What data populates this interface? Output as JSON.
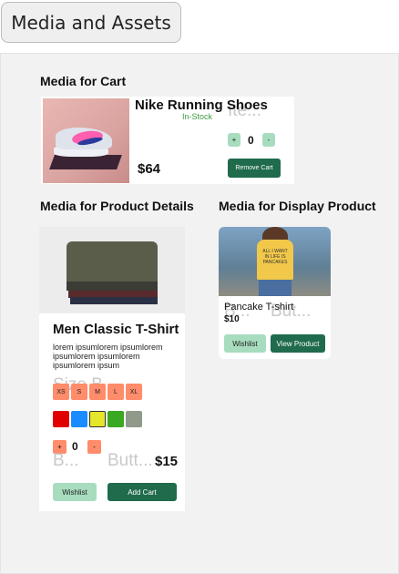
{
  "header": {
    "title": "Media and Assets"
  },
  "sections": {
    "cart": "Media for Cart",
    "details": "Media for Product Details",
    "display": "Media for Display Product"
  },
  "cart": {
    "product_name": "Nike Running Shoes",
    "stock_status": "In-Stock",
    "ghost_text": "Ite...",
    "quantity": "0",
    "increment_label": "+",
    "decrement_label": "-",
    "price": "$64",
    "remove_label": "Remove Cart",
    "image_icon": "shoe-image"
  },
  "product": {
    "title": "Men Classic T-Shirt",
    "description": "lorem ipsumlorem ipsumlorem ipsumlorem ipsumlorem ipsumlorem ipsum",
    "ghost_size": "Size B...",
    "ghost_button_1": "B...",
    "ghost_button_2": "Butt...",
    "sizes": [
      "XS",
      "S",
      "M",
      "L",
      "XL"
    ],
    "colors": [
      "#e00000",
      "#1a8cff",
      "#e6e62a",
      "#3aa820",
      "#8f9a8a"
    ],
    "quantity": "0",
    "increment_label": "+",
    "decrement_label": "-",
    "price": "$15",
    "wishlist_label": "Wishlist",
    "add_cart_label": "Add Cart"
  },
  "display": {
    "name": "Pancake T-shirt",
    "price": "$10",
    "ghost_1": "B...",
    "ghost_2": "But...",
    "wishlist_label": "Wishlist",
    "view_label": "View Product",
    "shirt_text": "ALL I WANT IN LIFE IS PANCAKES"
  },
  "colors": {
    "primary_green": "#1f6b4c",
    "light_green": "#a8dcbf",
    "accent_orange": "#ff8c6b",
    "stock_green": "#3c9b44"
  }
}
